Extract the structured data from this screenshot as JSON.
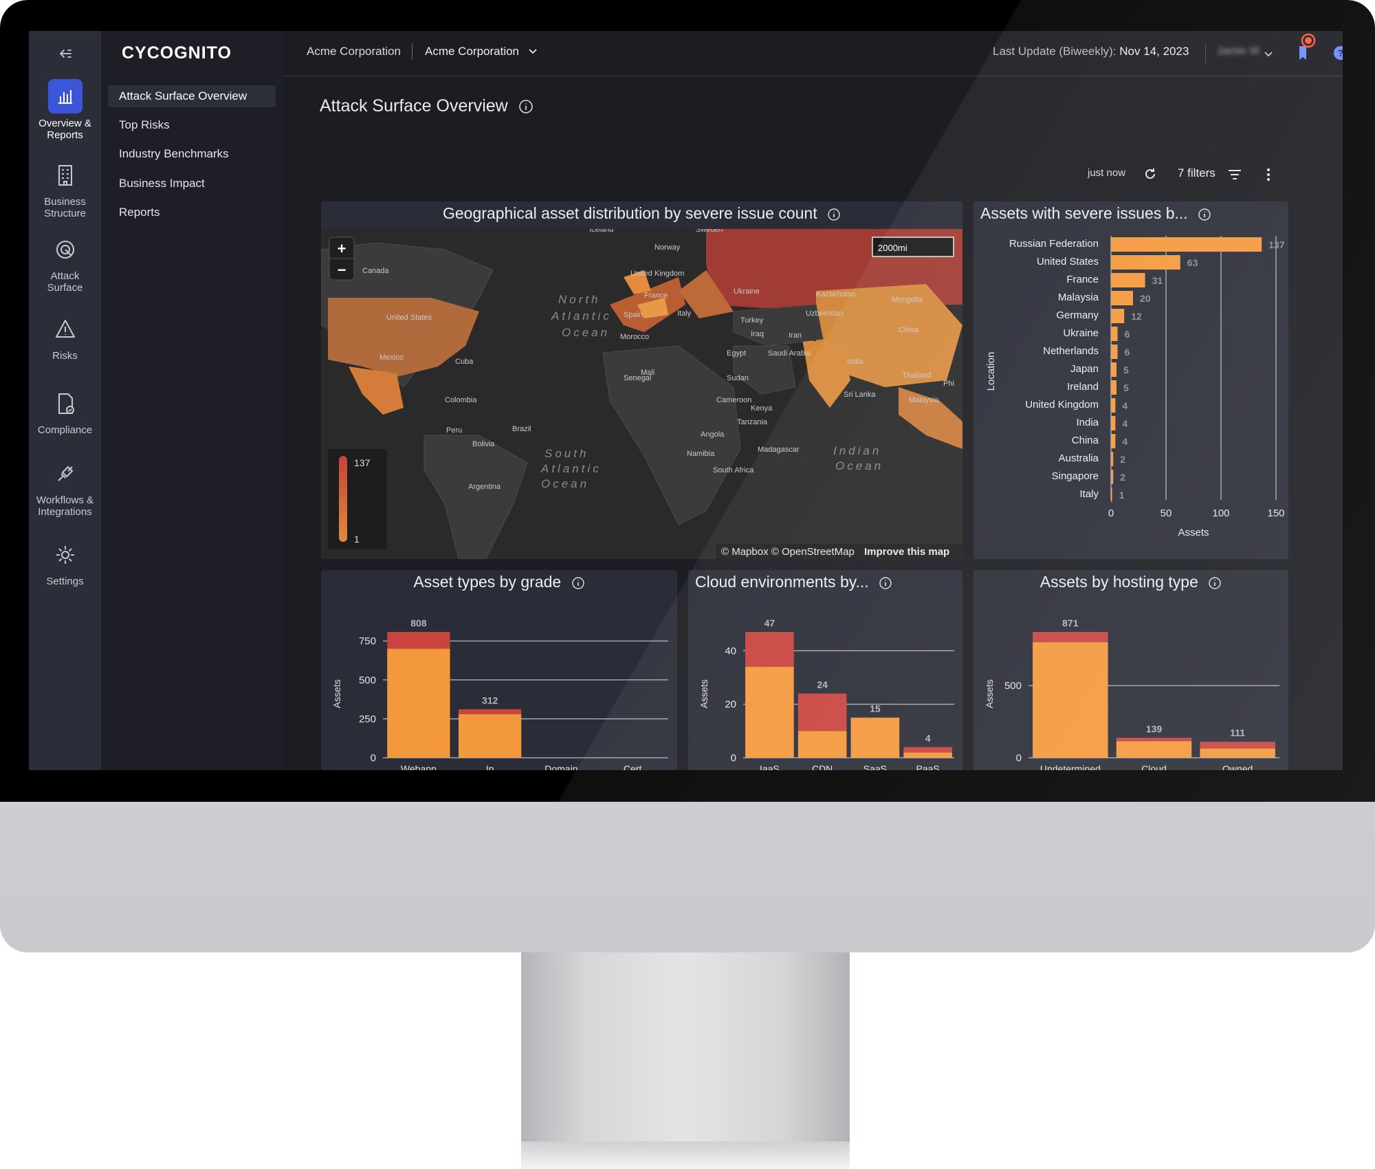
{
  "app": {
    "logo": "CYCOGNITO"
  },
  "rail": {
    "items": [
      {
        "label_line1": "Overview &",
        "label_line2": "Reports",
        "icon": "bar-chart-icon"
      },
      {
        "label_line1": "Business",
        "label_line2": "Structure",
        "icon": "building-icon"
      },
      {
        "label_line1": "Attack",
        "label_line2": "Surface",
        "icon": "target-icon"
      },
      {
        "label_line1": "Risks",
        "label_line2": "",
        "icon": "warning-icon"
      },
      {
        "label_line1": "Compliance",
        "label_line2": "",
        "icon": "document-check-icon"
      },
      {
        "label_line1": "Workflows &",
        "label_line2": "Integrations",
        "icon": "plug-icon"
      },
      {
        "label_line1": "Settings",
        "label_line2": "",
        "icon": "gear-icon"
      }
    ]
  },
  "nav": {
    "items": [
      "Attack Surface Overview",
      "Top Risks",
      "Industry Benchmarks",
      "Business Impact",
      "Reports"
    ]
  },
  "topbar": {
    "org_label": "Acme Corporation",
    "org_selector": "Acme Corporation",
    "last_update_label": "Last Update (Biweekly):",
    "last_update_value": "Nov 14, 2023",
    "user_name": "Jamie W"
  },
  "page": {
    "title": "Attack Surface Overview",
    "refreshed": "just now",
    "filters": "7 filters"
  },
  "map_panel": {
    "title": "Geographical asset distribution by severe issue count",
    "scale": "2000mi",
    "legend_max": "137",
    "legend_min": "1",
    "attribution_1": "© Mapbox © OpenStreetMap",
    "attribution_2": "Improve this map",
    "zoom_in": "+",
    "zoom_out": "−",
    "labels": [
      "Iceland",
      "Sweden",
      "Norway",
      "Canada",
      "United Kingdom",
      "Ukraine",
      "France",
      "Kazakhstan",
      "Mongolia",
      "North",
      "Atlantic",
      "Ocean",
      "United States",
      "Spain",
      "Italy",
      "Uzbekistan",
      "Turkey",
      "Morocco",
      "Iraq",
      "Iran",
      "China",
      "Mexico",
      "Cuba",
      "Egypt",
      "Saudi Arabia",
      "India",
      "Mali",
      "Senegal",
      "Sudan",
      "Thailand",
      "Colombia",
      "Sri Lanka",
      "Cameroon",
      "Malaysia",
      "Kenya",
      "Phi",
      "Peru",
      "Brazil",
      "Tanzania",
      "Bolivia",
      "Angola",
      "South",
      "Atlantic",
      "Ocean",
      "Namibia",
      "Madagascar",
      "Indian",
      "Ocean",
      "South Africa",
      "Argentina"
    ]
  },
  "colors": {
    "bar_orange": "#f4983d",
    "bar_red": "#c9443e",
    "map_high": "#c3433a",
    "map_low": "#e08a3c",
    "accent_blue": "#3b56d9"
  },
  "bars_panel": {
    "title": "Assets with severe issues b...",
    "chart_data": {
      "type": "bar",
      "orientation": "horizontal",
      "categories": [
        "Russian Federation",
        "United States",
        "France",
        "Malaysia",
        "Germany",
        "Ukraine",
        "Netherlands",
        "Japan",
        "Ireland",
        "United Kingdom",
        "India",
        "China",
        "Australia",
        "Singapore",
        "Italy"
      ],
      "values": [
        137,
        63,
        31,
        20,
        12,
        6,
        6,
        5,
        5,
        4,
        4,
        4,
        2,
        2,
        1
      ],
      "value_labels": [
        "137",
        "63",
        "31",
        "20",
        "12",
        "6",
        "6",
        "5",
        "5",
        "4",
        "4",
        "4",
        "2",
        "2",
        "1"
      ],
      "xlabel": "Assets",
      "ylabel": "Location",
      "xticks": [
        "0",
        "50",
        "100",
        "150"
      ],
      "xlim": [
        0,
        150
      ],
      "grid": true
    }
  },
  "grade_panel": {
    "title": "Asset types by grade",
    "chart_data": {
      "type": "bar",
      "stacked": true,
      "categories": [
        "Webapp",
        "Ip",
        "Domain",
        "Cert"
      ],
      "series": [
        {
          "values": [
            700,
            280,
            0,
            0
          ]
        },
        {
          "values": [
            108,
            32,
            0,
            0
          ]
        }
      ],
      "totals": [
        "808",
        "312",
        "",
        ""
      ],
      "ylabel": "Assets",
      "yticks": [
        "0",
        "250",
        "500",
        "750"
      ],
      "ylim": [
        0,
        808
      ],
      "grid": true
    }
  },
  "cloud_panel": {
    "title": "Cloud environments by...",
    "chart_data": {
      "type": "bar",
      "stacked": true,
      "categories": [
        "IaaS",
        "CDN",
        "SaaS",
        "PaaS"
      ],
      "series": [
        {
          "values": [
            34,
            10,
            15,
            2
          ]
        },
        {
          "values": [
            13,
            14,
            0,
            2
          ]
        }
      ],
      "totals": [
        "47",
        "24",
        "15",
        "4"
      ],
      "ylabel": "Assets",
      "yticks": [
        "0",
        "20",
        "40"
      ],
      "ylim": [
        0,
        47
      ],
      "grid": true
    }
  },
  "hosting_panel": {
    "title": "Assets by hosting type",
    "chart_data": {
      "type": "bar",
      "stacked": true,
      "categories": [
        "Undetermined",
        "Cloud",
        "Owned"
      ],
      "series": [
        {
          "values": [
            800,
            115,
            65
          ]
        },
        {
          "values": [
            71,
            24,
            46
          ]
        }
      ],
      "totals": [
        "871",
        "139",
        "111"
      ],
      "ylabel": "Assets",
      "yticks": [
        "0",
        "500"
      ],
      "ylim": [
        0,
        871
      ],
      "grid": true
    }
  }
}
